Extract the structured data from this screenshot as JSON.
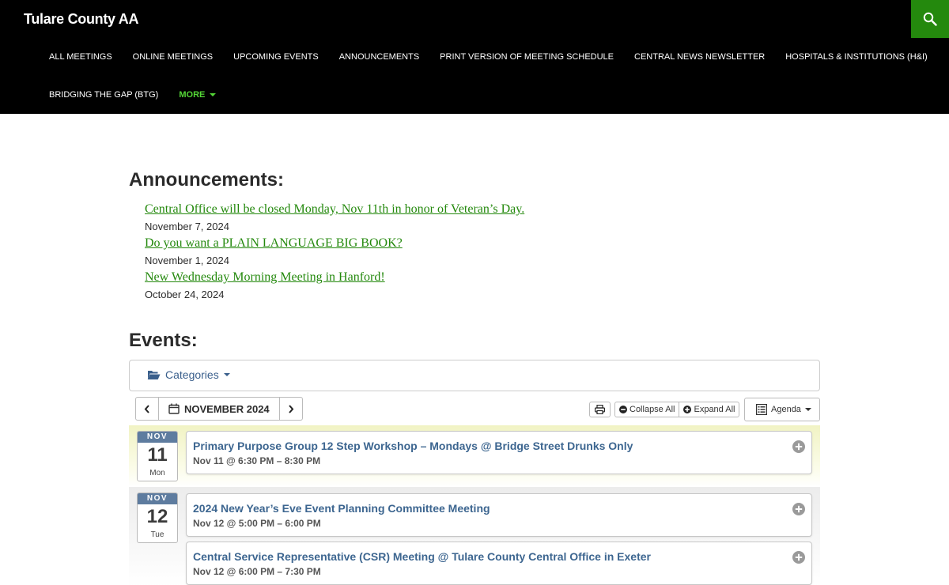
{
  "site": {
    "title": "Tulare County AA"
  },
  "nav": {
    "items": [
      "ALL MEETINGS",
      "ONLINE MEETINGS",
      "UPCOMING EVENTS",
      "ANNOUNCEMENTS",
      "PRINT VERSION OF MEETING SCHEDULE",
      "CENTRAL NEWS NEWSLETTER",
      "HOSPITALS & INSTITUTIONS (H&I)",
      "BRIDGING THE GAP (BTG)"
    ],
    "more_label": "MORE"
  },
  "announcements": {
    "heading": "Announcements:",
    "items": [
      {
        "title": "Central Office will be closed Monday, Nov 11th in honor of Veteran’s Day.",
        "date": "November 7, 2024"
      },
      {
        "title": "Do you want a PLAIN LANGUAGE BIG BOOK?",
        "date": "November 1, 2024"
      },
      {
        "title": "New Wednesday Morning Meeting in Hanford!",
        "date": "October 24, 2024"
      }
    ]
  },
  "events": {
    "heading": "Events:",
    "categories_label": "Categories",
    "month_label": "NOVEMBER 2024",
    "collapse_label": "Collapse All",
    "expand_label": "Expand All",
    "view_label": "Agenda",
    "days": [
      {
        "month": "NOV",
        "day": "11",
        "weekday": "Mon",
        "events": [
          {
            "title": "Primary Purpose Group 12 Step Workshop – Mondays @ Bridge Street Drunks Only",
            "time": "Nov 11 @ 6:30 PM – 8:30 PM"
          }
        ]
      },
      {
        "month": "NOV",
        "day": "12",
        "weekday": "Tue",
        "events": [
          {
            "title": "2024 New Year’s Eve Event Planning Committee Meeting",
            "time": "Nov 12 @ 5:00 PM – 6:00 PM"
          },
          {
            "title": "Central Service Representative (CSR) Meeting @ Tulare County Central Office in Exeter",
            "time": "Nov 12 @ 6:00 PM – 7:30 PM"
          }
        ]
      }
    ]
  },
  "colors": {
    "accent_green": "#24890d",
    "more_green": "#55d737",
    "event_blue": "#3d6690",
    "date_header": "#5e7c9f"
  }
}
